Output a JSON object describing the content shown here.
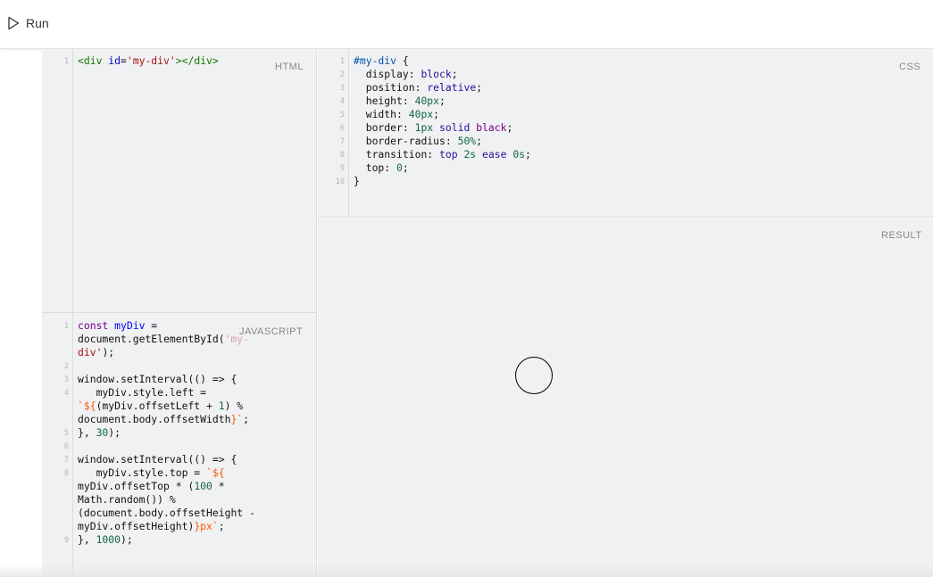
{
  "toolbar": {
    "run_label": "Run"
  },
  "html_panel": {
    "label": "HTML",
    "line_number": "1",
    "code_tag_open": "<div",
    "code_attr": "id",
    "code_eq": "=",
    "code_value": "'my-div'",
    "code_tag_rest": "></div>"
  },
  "css_panel": {
    "label": "CSS",
    "line_numbers": [
      "1",
      "2",
      "3",
      "4",
      "5",
      "6",
      "7",
      "8",
      "9",
      "10"
    ],
    "selector": "#my-div",
    "open_brace": " {",
    "close_brace": "}",
    "props": [
      {
        "name": "display",
        "value": "block"
      },
      {
        "name": "position",
        "value": "relative"
      },
      {
        "name": "height",
        "value": "40px"
      },
      {
        "name": "width",
        "value": "40px"
      },
      {
        "name": "border",
        "value1": "1px",
        "value2": "solid",
        "value3": "black"
      },
      {
        "name": "border-radius",
        "value": "50%"
      },
      {
        "name": "transition",
        "value1": "top",
        "value2": "2s",
        "value3": "ease",
        "value4": "0s"
      },
      {
        "name": "top",
        "value": "0"
      }
    ]
  },
  "js_panel": {
    "label": "JAVASCRIPT",
    "line_numbers": [
      "1",
      "2",
      "3",
      "4",
      "5",
      "6",
      "7",
      "8",
      "9"
    ]
  },
  "result_panel": {
    "label": "RESULT"
  }
}
